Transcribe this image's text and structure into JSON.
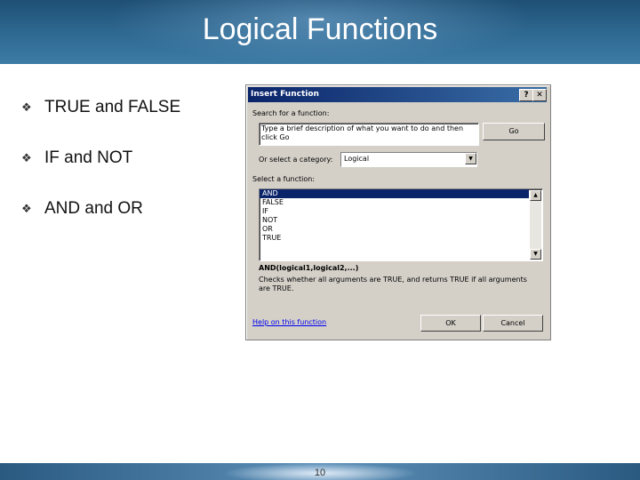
{
  "slide": {
    "title": "Logical Functions",
    "page_number": "10",
    "bullet_glyph": "❖",
    "bullets": [
      {
        "label": "TRUE and FALSE"
      },
      {
        "label": "IF and NOT"
      },
      {
        "label": "AND and OR"
      }
    ]
  },
  "dialog": {
    "title": "Insert Function",
    "help_btn": "?",
    "close_btn": "✕",
    "search_label": "Search for a function:",
    "search_value": "Type a brief description of what you want to do and then click Go",
    "go_button": "Go",
    "category_label": "Or select a category:",
    "category_value": "Logical",
    "function_label": "Select a function:",
    "functions": [
      "AND",
      "FALSE",
      "IF",
      "NOT",
      "OR",
      "TRUE"
    ],
    "selected_function": "AND",
    "signature": "AND(logical1,logical2,...)",
    "description": "Checks whether all arguments are TRUE, and returns TRUE if all arguments are TRUE.",
    "help_link": "Help on this function",
    "ok_button": "OK",
    "cancel_button": "Cancel"
  },
  "colors": {
    "header": "#2f6a93",
    "dialog_titlebar": "#0a246a",
    "selection": "#0a246a"
  }
}
